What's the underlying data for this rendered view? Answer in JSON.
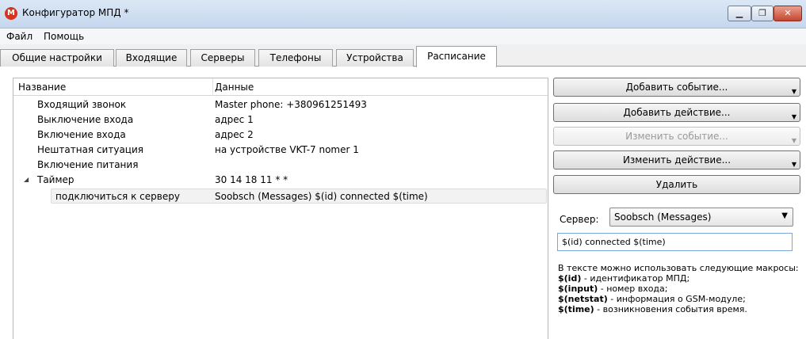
{
  "window": {
    "title": "Конфигуратор МПД *",
    "app_icon": "M"
  },
  "menu": [
    {
      "label": "Файл"
    },
    {
      "label": "Помощь"
    }
  ],
  "tabs": [
    {
      "label": "Общие настройки"
    },
    {
      "label": "Входящие"
    },
    {
      "label": "Серверы"
    },
    {
      "label": "Телефоны"
    },
    {
      "label": "Устройства"
    },
    {
      "label": "Расписание",
      "active": true
    }
  ],
  "tree": {
    "columns": {
      "name": "Название",
      "data": "Данные"
    },
    "rows": [
      {
        "name": "Входящий звонок",
        "value": "Master phone: +380961251493"
      },
      {
        "name": "Выключение входа",
        "value": "адрес 1"
      },
      {
        "name": "Включение входа",
        "value": "адрес 2"
      },
      {
        "name": "Нештатная ситуация",
        "value": "на устройстве VKT-7 nomer  1"
      },
      {
        "name": "Включение питания",
        "value": ""
      },
      {
        "name": "Таймер",
        "value": "30  14  18  11  *  *",
        "expanded": true
      },
      {
        "name": "подключиться к серверу",
        "value": "Soobsch (Messages) $(id) connected $(time)",
        "selected": true
      }
    ]
  },
  "actions": {
    "add_event": "Добавить событие...",
    "add_action": "Добавить действие...",
    "edit_event": "Изменить событие...",
    "edit_action": "Изменить действие...",
    "delete": "Удалить"
  },
  "server": {
    "label": "Сервер:",
    "selected": "Soobsch (Messages)",
    "message": "$(id) connected $(time)"
  },
  "help": {
    "intro": "В тексте можно использовать следующие макросы:",
    "macros": [
      {
        "name": "$(id)",
        "desc": " - идентификатор МПД;"
      },
      {
        "name": "$(input)",
        "desc": " - номер входа;"
      },
      {
        "name": "$(netstat)",
        "desc": " - информация о GSM-модуле;"
      },
      {
        "name": "$(time)",
        "desc": " - возникновения события время."
      }
    ]
  }
}
